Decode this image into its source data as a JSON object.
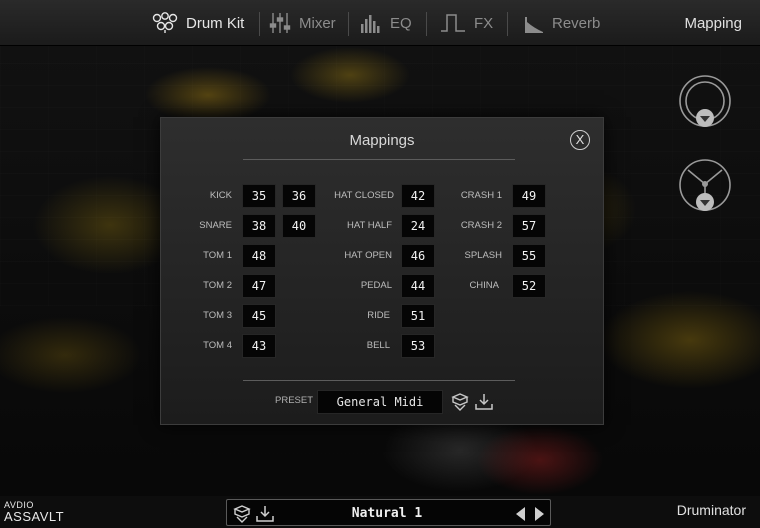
{
  "nav": {
    "items": [
      {
        "label": "Drum Kit",
        "icon": "drum-kit-icon",
        "active": true
      },
      {
        "label": "Mixer",
        "icon": "mixer-icon",
        "active": false
      },
      {
        "label": "EQ",
        "icon": "eq-icon",
        "active": false
      },
      {
        "label": "FX",
        "icon": "fx-icon",
        "active": false
      },
      {
        "label": "Reverb",
        "icon": "reverb-icon",
        "active": false
      }
    ],
    "mapping_label": "Mapping"
  },
  "modal": {
    "title": "Mappings",
    "close_label": "X",
    "col1": [
      {
        "label": "KICK",
        "values": [
          "35",
          "36"
        ]
      },
      {
        "label": "SNARE",
        "values": [
          "38",
          "40"
        ]
      },
      {
        "label": "TOM 1",
        "values": [
          "48"
        ]
      },
      {
        "label": "TOM 2",
        "values": [
          "47"
        ]
      },
      {
        "label": "TOM 3",
        "values": [
          "45"
        ]
      },
      {
        "label": "TOM 4",
        "values": [
          "43"
        ]
      }
    ],
    "col2": [
      {
        "label": "HAT CLOSED",
        "values": [
          "42"
        ]
      },
      {
        "label": "HAT HALF",
        "values": [
          "24"
        ]
      },
      {
        "label": "HAT OPEN",
        "values": [
          "46"
        ]
      },
      {
        "label": "PEDAL",
        "values": [
          "44"
        ]
      },
      {
        "label": "RIDE",
        "values": [
          "51"
        ]
      },
      {
        "label": "BELL",
        "values": [
          "53"
        ]
      }
    ],
    "col3": [
      {
        "label": "CRASH 1",
        "values": [
          "49"
        ]
      },
      {
        "label": "CRASH 2",
        "values": [
          "57"
        ]
      },
      {
        "label": "SPLASH",
        "values": [
          "55"
        ]
      },
      {
        "label": "CHINA",
        "values": [
          "52"
        ]
      }
    ],
    "preset_label": "PRESET",
    "preset_value": "General Midi"
  },
  "bottom": {
    "brand_top": "AVDIO",
    "brand_bottom": "ASSAVLT",
    "preset_name": "Natural 1",
    "product": "Druminator"
  },
  "colors": {
    "accent": "#e6e6e6",
    "muted": "#8c8c8c",
    "field_bg": "#050505"
  }
}
